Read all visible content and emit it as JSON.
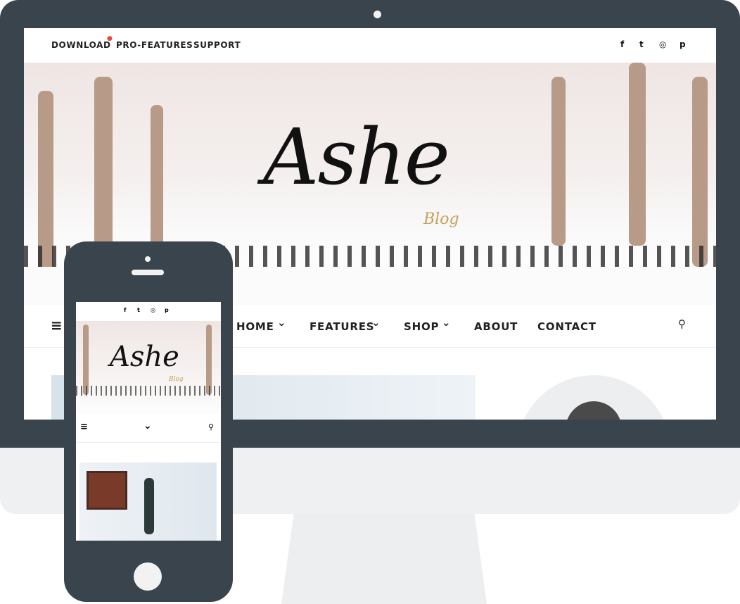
{
  "desktop": {
    "top_links": [
      "DOWNLOAD",
      "PRO-FEATURES",
      "SUPPORT"
    ],
    "social_icons": [
      "facebook-icon",
      "twitter-icon",
      "instagram-icon",
      "pinterest-icon"
    ],
    "social_glyphs": [
      "f",
      "t",
      "◎",
      "p"
    ],
    "logo": "Ashe",
    "logo_sub": "Blog",
    "nav": [
      {
        "label": "HOME",
        "dropdown": true
      },
      {
        "label": "FEATURES",
        "dropdown": true
      },
      {
        "label": "SHOP",
        "dropdown": true
      },
      {
        "label": "ABOUT",
        "dropdown": false
      },
      {
        "label": "CONTACT",
        "dropdown": false
      }
    ],
    "menu_glyph": "≡",
    "search_glyph": "⚲",
    "chevron": "⌄"
  },
  "mobile": {
    "logo": "Ashe",
    "logo_sub": "Blog"
  },
  "colors": {
    "frame": "#3a444d",
    "accent": "#c9a05a",
    "badge": "#e44444"
  }
}
